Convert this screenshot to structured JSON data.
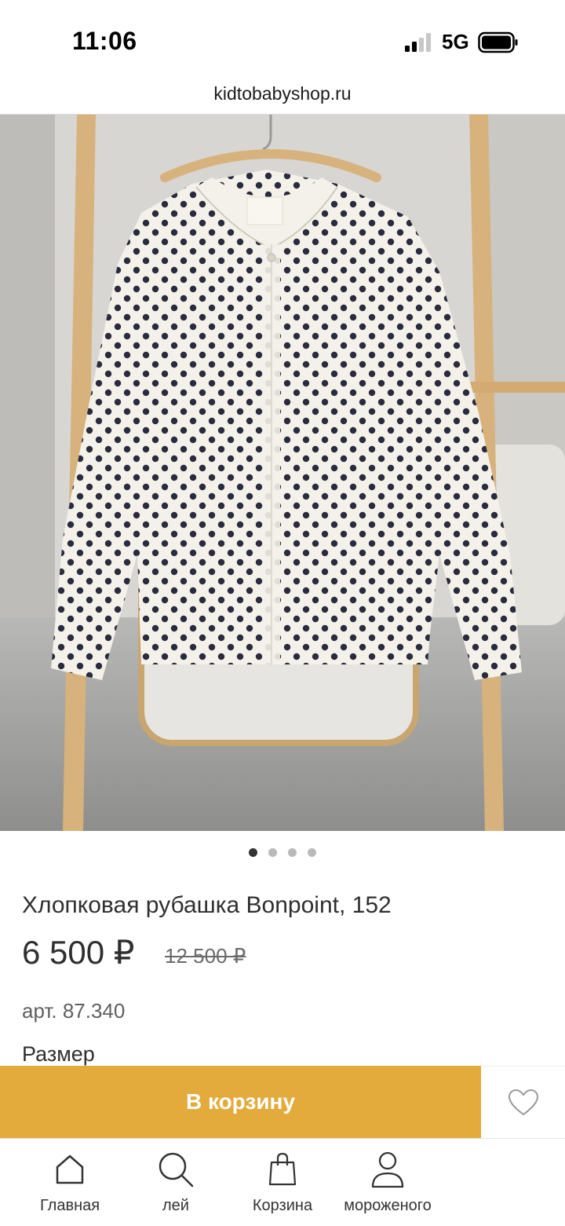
{
  "status_bar": {
    "time": "11:06",
    "network": "5G"
  },
  "browser": {
    "url": "kidtobabyshop.ru"
  },
  "carousel": {
    "total": 4,
    "active_index": 0
  },
  "product": {
    "title": "Хлопковая рубашка Bonpoint, 152",
    "price": "6 500 ₽",
    "old_price": "12 500 ₽",
    "sku": "арт. 87.340",
    "size_label": "Размер"
  },
  "actions": {
    "add_to_cart": "В корзину",
    "favorite_icon": "heart-icon"
  },
  "tab_bar": [
    {
      "label": "Главная",
      "icon": "home-icon"
    },
    {
      "label": "лей",
      "icon": "search-icon"
    },
    {
      "label": "Корзина",
      "icon": "bag-icon"
    },
    {
      "label": "мороженого",
      "icon": "user-icon"
    }
  ],
  "colors": {
    "accent": "#e3aa3c",
    "dot_active": "#333333",
    "dot_inactive": "#b9b9b9"
  }
}
